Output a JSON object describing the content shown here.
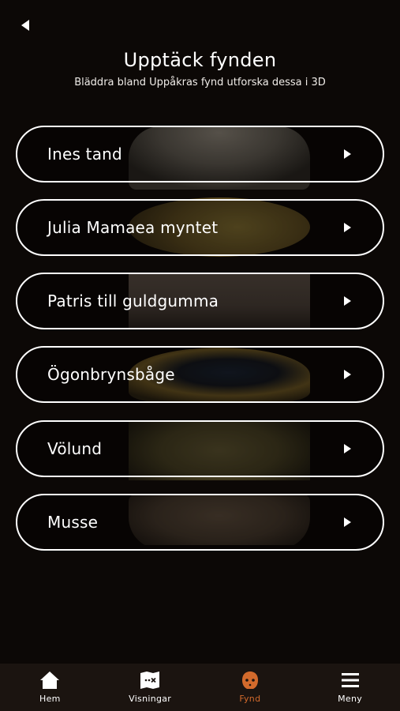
{
  "header": {
    "back_label": "Back",
    "title": "Upptäck fynden",
    "subtitle": "Bläddra bland Uppåkras fynd utforska dessa i 3D"
  },
  "finds": [
    {
      "label": "Ines tand",
      "icon": "play-triangle-icon"
    },
    {
      "label": "Julia Mamaea myntet",
      "icon": "play-triangle-icon"
    },
    {
      "label": "Patris till guldgumma",
      "icon": "play-triangle-icon"
    },
    {
      "label": "Ögonbrynsbåge",
      "icon": "play-triangle-icon"
    },
    {
      "label": "Völund",
      "icon": "play-triangle-icon"
    },
    {
      "label": "Musse",
      "icon": "play-triangle-icon"
    }
  ],
  "tabbar": {
    "tabs": [
      {
        "label": "Hem",
        "icon": "home-icon",
        "active": false
      },
      {
        "label": "Visningar",
        "icon": "map-icon",
        "active": false
      },
      {
        "label": "Fynd",
        "icon": "artifact-head-icon",
        "active": true
      },
      {
        "label": "Meny",
        "icon": "hamburger-menu-icon",
        "active": false
      }
    ]
  },
  "colors": {
    "background": "#0c0806",
    "tabbar_bg": "#1b1410",
    "accent": "#d26a2c",
    "text": "#ffffff"
  }
}
